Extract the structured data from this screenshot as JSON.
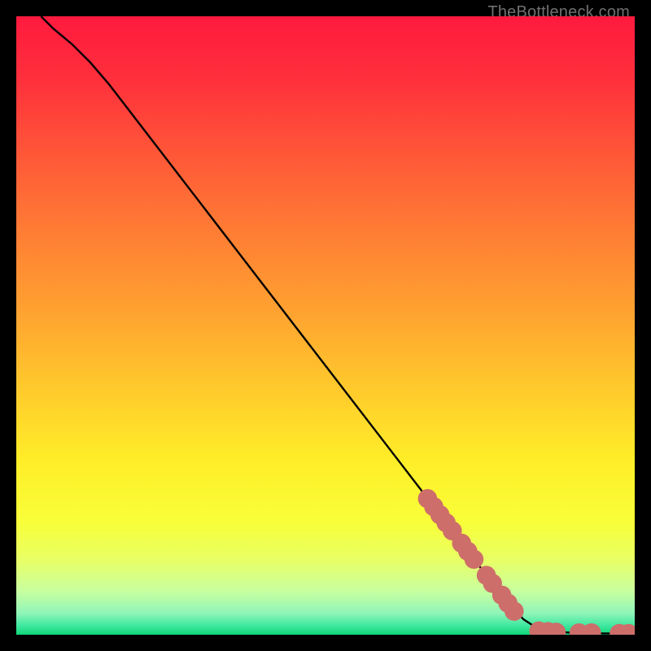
{
  "attribution": "TheBottleneck.com",
  "chart_data": {
    "type": "line",
    "title": "",
    "xlabel": "",
    "ylabel": "",
    "xlim": [
      0,
      100
    ],
    "ylim": [
      0,
      100
    ],
    "curve": {
      "name": "main-curve",
      "points": [
        {
          "x": 4.0,
          "y": 100.0
        },
        {
          "x": 6.0,
          "y": 98.0
        },
        {
          "x": 9.0,
          "y": 95.5
        },
        {
          "x": 12.0,
          "y": 92.5
        },
        {
          "x": 15.0,
          "y": 89.0
        },
        {
          "x": 20.0,
          "y": 82.5
        },
        {
          "x": 30.0,
          "y": 69.5
        },
        {
          "x": 40.0,
          "y": 56.5
        },
        {
          "x": 50.0,
          "y": 43.5
        },
        {
          "x": 60.0,
          "y": 30.5
        },
        {
          "x": 70.0,
          "y": 17.5
        },
        {
          "x": 78.0,
          "y": 7.0
        },
        {
          "x": 82.0,
          "y": 2.5
        },
        {
          "x": 84.0,
          "y": 1.2
        },
        {
          "x": 86.0,
          "y": 0.6
        },
        {
          "x": 90.0,
          "y": 0.3
        },
        {
          "x": 95.0,
          "y": 0.2
        },
        {
          "x": 100.0,
          "y": 0.2
        }
      ]
    },
    "markers": {
      "name": "diagonal-dot-cluster",
      "color": "#cd6e6a",
      "radius": 1.55,
      "points": [
        {
          "x": 66.5,
          "y": 22.0
        },
        {
          "x": 67.5,
          "y": 20.7
        },
        {
          "x": 68.5,
          "y": 19.4
        },
        {
          "x": 69.5,
          "y": 18.1
        },
        {
          "x": 70.5,
          "y": 16.8
        },
        {
          "x": 72.0,
          "y": 14.8
        },
        {
          "x": 73.0,
          "y": 13.5
        },
        {
          "x": 74.0,
          "y": 12.2
        },
        {
          "x": 76.0,
          "y": 9.6
        },
        {
          "x": 77.0,
          "y": 8.3
        },
        {
          "x": 78.5,
          "y": 6.4
        },
        {
          "x": 79.5,
          "y": 5.1
        },
        {
          "x": 80.5,
          "y": 3.8
        }
      ]
    },
    "tail_markers": {
      "name": "tail-dot-cluster",
      "color": "#cd6e6a",
      "radius": 1.55,
      "points": [
        {
          "x": 84.5,
          "y": 0.6
        },
        {
          "x": 86.0,
          "y": 0.5
        },
        {
          "x": 87.3,
          "y": 0.4
        },
        {
          "x": 91.0,
          "y": 0.3
        },
        {
          "x": 93.0,
          "y": 0.3
        },
        {
          "x": 97.5,
          "y": 0.2
        },
        {
          "x": 99.0,
          "y": 0.2
        }
      ]
    },
    "gradient_stops": [
      {
        "offset": 0.0,
        "color": "#ff1a3e"
      },
      {
        "offset": 0.1,
        "color": "#ff2f3c"
      },
      {
        "offset": 0.22,
        "color": "#ff5638"
      },
      {
        "offset": 0.35,
        "color": "#ff7d34"
      },
      {
        "offset": 0.48,
        "color": "#ffa330"
      },
      {
        "offset": 0.6,
        "color": "#ffc92c"
      },
      {
        "offset": 0.72,
        "color": "#ffee28"
      },
      {
        "offset": 0.82,
        "color": "#f8ff3a"
      },
      {
        "offset": 0.88,
        "color": "#e8ff66"
      },
      {
        "offset": 0.93,
        "color": "#c8ffa0"
      },
      {
        "offset": 0.965,
        "color": "#90f5b8"
      },
      {
        "offset": 0.985,
        "color": "#40e8a0"
      },
      {
        "offset": 1.0,
        "color": "#10d878"
      }
    ]
  }
}
